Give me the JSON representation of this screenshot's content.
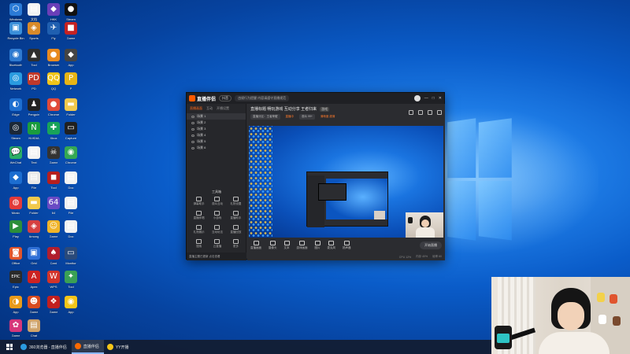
{
  "desktop": {
    "icons": [
      {
        "name": "desktop-icon-1",
        "glyph": "⬡",
        "color": "#2b7bd6",
        "label": "Windows"
      },
      {
        "name": "desktop-icon-2",
        "glyph": "▤",
        "color": "#f2f2f2",
        "label": "文档"
      },
      {
        "name": "desktop-icon-3",
        "glyph": "◆",
        "color": "#6a3fb8",
        "label": "HKK"
      },
      {
        "name": "desktop-icon-4",
        "glyph": "●",
        "color": "#111111",
        "label": "Steam"
      },
      {
        "name": "desktop-icon-5",
        "glyph": "▣",
        "color": "#3a8fd9",
        "label": "Recycle Bin"
      },
      {
        "name": "desktop-icon-6",
        "glyph": "◈",
        "color": "#d88a2a",
        "label": "Sports"
      },
      {
        "name": "desktop-icon-7",
        "glyph": "✈",
        "color": "#1f5fb0",
        "label": "Fly"
      },
      {
        "name": "desktop-icon-8",
        "glyph": "■",
        "color": "#c52222",
        "label": "Game"
      },
      {
        "name": "desktop-icon-9",
        "glyph": "◉",
        "color": "#2f7ad0",
        "label": "Bluetooth"
      },
      {
        "name": "desktop-icon-10",
        "glyph": "▲",
        "color": "#2e2e2e",
        "label": "Tool"
      },
      {
        "name": "desktop-icon-11",
        "glyph": "●",
        "color": "#e88a1f",
        "label": "Browser"
      },
      {
        "name": "desktop-icon-12",
        "glyph": "◆",
        "color": "#444444",
        "label": "App"
      },
      {
        "name": "desktop-icon-13",
        "glyph": "◎",
        "color": "#2a9be0",
        "label": "Network"
      },
      {
        "name": "desktop-icon-14",
        "glyph": "PD",
        "color": "#c0392b",
        "label": "PD"
      },
      {
        "name": "desktop-icon-15",
        "glyph": "QQ",
        "color": "#f0c419",
        "label": "QQ"
      },
      {
        "name": "desktop-icon-16",
        "glyph": "P",
        "color": "#e7b416",
        "label": "P"
      },
      {
        "name": "desktop-icon-17",
        "glyph": "◐",
        "color": "#1e6fd0",
        "label": "Edge"
      },
      {
        "name": "desktop-icon-18",
        "glyph": "♟",
        "color": "#222222",
        "label": "Penguin"
      },
      {
        "name": "desktop-icon-19",
        "glyph": "●",
        "color": "#e04a3a",
        "label": "Chrome"
      },
      {
        "name": "desktop-icon-20",
        "glyph": "▬",
        "color": "#f2c94c",
        "label": "Folder"
      },
      {
        "name": "desktop-icon-21",
        "glyph": "◎",
        "color": "#1b2838",
        "label": "Steam"
      },
      {
        "name": "desktop-icon-22",
        "glyph": "N",
        "color": "#1a9c3e",
        "label": "NVIDIA"
      },
      {
        "name": "desktop-icon-23",
        "glyph": "✚",
        "color": "#18a35a",
        "label": "Xbox"
      },
      {
        "name": "desktop-icon-24",
        "glyph": "▭",
        "color": "#202020",
        "label": "Capture"
      },
      {
        "name": "desktop-icon-25",
        "glyph": "💬",
        "color": "#2aae67",
        "label": "WeChat"
      },
      {
        "name": "desktop-icon-26",
        "glyph": "▤",
        "color": "#f2f2f2",
        "label": "Text"
      },
      {
        "name": "desktop-icon-27",
        "glyph": "☠",
        "color": "#333333",
        "label": "Game"
      },
      {
        "name": "desktop-icon-28",
        "glyph": "◉",
        "color": "#34a853",
        "label": "Chrome"
      },
      {
        "name": "desktop-icon-29",
        "glyph": "◆",
        "color": "#1c6dd0",
        "label": "App"
      },
      {
        "name": "desktop-icon-30",
        "glyph": "▤",
        "color": "#e8e8e8",
        "label": "File"
      },
      {
        "name": "desktop-icon-31",
        "glyph": "◼",
        "color": "#b51f1f",
        "label": "Tool"
      },
      {
        "name": "desktop-icon-32",
        "glyph": "▤",
        "color": "#f2f2f2",
        "label": "Doc"
      },
      {
        "name": "desktop-icon-33",
        "glyph": "◍",
        "color": "#e23a3a",
        "label": "Music"
      },
      {
        "name": "desktop-icon-34",
        "glyph": "▬",
        "color": "#f2c94c",
        "label": "Folder"
      },
      {
        "name": "desktop-icon-35",
        "glyph": "64",
        "color": "#6a4bc4",
        "label": "64"
      },
      {
        "name": "desktop-icon-36",
        "glyph": "▤",
        "color": "#f2f2f2",
        "label": "File"
      },
      {
        "name": "desktop-icon-37",
        "glyph": "▶",
        "color": "#2c8f3a",
        "label": "Play"
      },
      {
        "name": "desktop-icon-38",
        "glyph": "◈",
        "color": "#d64040",
        "label": "Among"
      },
      {
        "name": "desktop-icon-39",
        "glyph": "☺",
        "color": "#f0b429",
        "label": "Game"
      },
      {
        "name": "desktop-icon-40",
        "glyph": "▤",
        "color": "#f2f2f2",
        "label": "Doc"
      },
      {
        "name": "desktop-icon-41",
        "glyph": "◙",
        "color": "#e2542a",
        "label": "Office"
      },
      {
        "name": "desktop-icon-42",
        "glyph": "▣",
        "color": "#2f6fd6",
        "label": "Grid"
      },
      {
        "name": "desktop-icon-43",
        "glyph": "♠",
        "color": "#b01e2e",
        "label": "Card"
      },
      {
        "name": "desktop-icon-44",
        "glyph": "▭",
        "color": "#2a4a7a",
        "label": "Monitor"
      },
      {
        "name": "desktop-icon-45",
        "glyph": "EPIC",
        "color": "#2a2a2a",
        "label": "Epic"
      },
      {
        "name": "desktop-icon-46",
        "glyph": "A",
        "color": "#cc2222",
        "label": "Apex"
      },
      {
        "name": "desktop-icon-47",
        "glyph": "W",
        "color": "#d2342a",
        "label": "WPS"
      },
      {
        "name": "desktop-icon-48",
        "glyph": "✦",
        "color": "#3aa055",
        "label": "Tool"
      },
      {
        "name": "desktop-icon-49",
        "glyph": "◑",
        "color": "#e89a1a",
        "label": "App"
      },
      {
        "name": "desktop-icon-50",
        "glyph": "☻",
        "color": "#d84b20",
        "label": "Game"
      },
      {
        "name": "desktop-icon-51",
        "glyph": "❖",
        "color": "#c21f1f",
        "label": "Game"
      },
      {
        "name": "desktop-icon-52",
        "glyph": "◉",
        "color": "#f5c518",
        "label": "App"
      },
      {
        "name": "desktop-icon-53",
        "glyph": "✿",
        "color": "#d6377a",
        "label": "Game"
      },
      {
        "name": "desktop-icon-54",
        "glyph": "▤",
        "color": "#cfa36a",
        "label": "Chat"
      }
    ]
  },
  "app": {
    "title_logo": "直播伴侣",
    "version_pill": "抖音",
    "notice": "违规行为提醒 内容请遵守直播规范",
    "window_controls": [
      "—",
      "□",
      "✕"
    ],
    "left_tabs": [
      {
        "label": "直播画面",
        "active": true
      },
      {
        "label": "互动",
        "active": false
      },
      {
        "label": "开播设置",
        "active": false
      }
    ],
    "scenes": [
      {
        "label": "场景 1",
        "selected": true
      },
      {
        "label": "场景 2",
        "selected": false
      },
      {
        "label": "场景 3",
        "selected": false
      },
      {
        "label": "场景 4",
        "selected": false
      },
      {
        "label": "场景 5",
        "selected": false
      },
      {
        "label": "场景 6",
        "selected": false
      }
    ],
    "tools_title": "工具箱",
    "tools": [
      {
        "name": "tool-1",
        "label": "弹幕助手"
      },
      {
        "name": "tool-2",
        "label": "观众互动"
      },
      {
        "name": "tool-3",
        "label": "礼物设置"
      },
      {
        "name": "tool-4",
        "label": "直播伴唱"
      },
      {
        "name": "tool-5",
        "label": "小游戏"
      },
      {
        "name": "tool-6",
        "label": "直播助手"
      },
      {
        "name": "tool-7",
        "label": "礼物展示"
      },
      {
        "name": "tool-8",
        "label": "互动玩法"
      },
      {
        "name": "tool-9",
        "label": "直播回放"
      },
      {
        "name": "tool-10",
        "label": "搜索"
      },
      {
        "name": "tool-11",
        "label": "云直播"
      },
      {
        "name": "tool-12",
        "label": "更多"
      }
    ],
    "left_status": "直播主题已更新 点击查看",
    "stream_title": "直播标题 畅玩游戏 互动分享 王者归来",
    "stream_tag": "游戏",
    "sub_tags": [
      {
        "label": "直播分区：王者荣耀",
        "orange": false
      },
      {
        "label": "直播中",
        "orange": true
      },
      {
        "label": "观众 99+",
        "orange": false
      },
      {
        "label": "清晰度 超清",
        "orange": true
      }
    ],
    "controls": [
      {
        "name": "ctrl-1",
        "label": "直播画面"
      },
      {
        "name": "ctrl-2",
        "label": "摄像头"
      },
      {
        "name": "ctrl-3",
        "label": "文本"
      },
      {
        "name": "ctrl-4",
        "label": "游戏画面"
      },
      {
        "name": "ctrl-5",
        "label": "图片"
      },
      {
        "name": "ctrl-6",
        "label": "麦克风"
      },
      {
        "name": "ctrl-7",
        "label": "扬声器"
      }
    ],
    "go_live": "开始直播",
    "status_items": [
      "CPU 12%",
      "内存 40%",
      "帧率 60"
    ]
  },
  "taskbar": {
    "items": [
      {
        "name": "taskbar-item-browser",
        "label": "360浏览器 - 直播伴侣",
        "color": "#2a9be0",
        "active": false
      },
      {
        "name": "taskbar-item-app",
        "label": "直播伴侣",
        "color": "#ff6a00",
        "active": true
      },
      {
        "name": "taskbar-item-other",
        "label": "YY开播",
        "color": "#f5c518",
        "active": false
      }
    ]
  }
}
